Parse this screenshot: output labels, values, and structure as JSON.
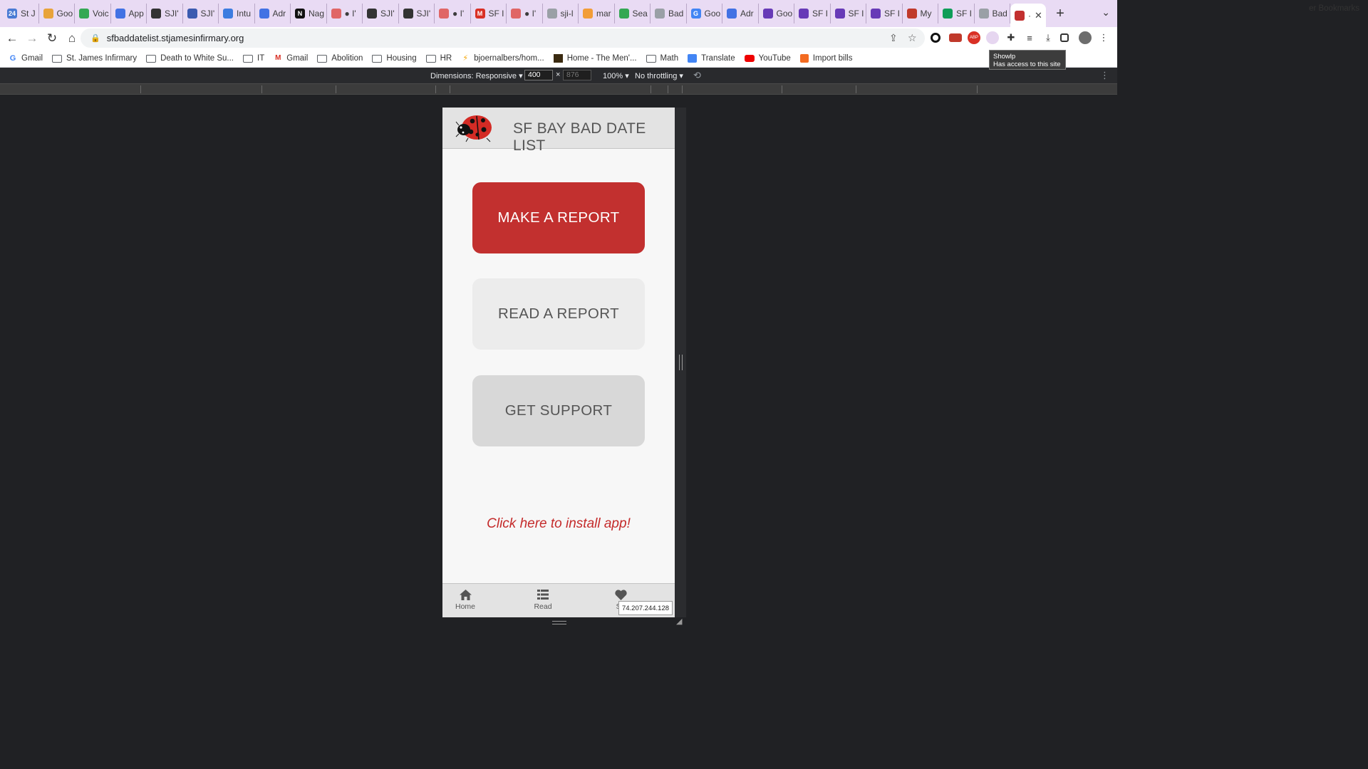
{
  "browser": {
    "tabs": [
      {
        "label": "St J",
        "color": "#4a7bd4",
        "glyph": "24"
      },
      {
        "label": "Goo",
        "color": "#e8a33b",
        "glyph": ""
      },
      {
        "label": "Voic",
        "color": "#34a853",
        "glyph": ""
      },
      {
        "label": "App",
        "color": "#4272e4",
        "glyph": ""
      },
      {
        "label": "SJI'",
        "color": "#333333",
        "glyph": ""
      },
      {
        "label": "SJI'",
        "color": "#3b5bb0",
        "glyph": ""
      },
      {
        "label": "Intu",
        "color": "#3c7ce0",
        "glyph": ""
      },
      {
        "label": "Adr",
        "color": "#4272e4",
        "glyph": ""
      },
      {
        "label": "Nag",
        "color": "#111111",
        "glyph": "N"
      },
      {
        "label": "● I'",
        "color": "#e06666",
        "glyph": ""
      },
      {
        "label": "SJI'",
        "color": "#333333",
        "glyph": ""
      },
      {
        "label": "SJI'",
        "color": "#333333",
        "glyph": ""
      },
      {
        "label": "● I'",
        "color": "#e06666",
        "glyph": ""
      },
      {
        "label": "SF I",
        "color": "#d93025",
        "glyph": "M"
      },
      {
        "label": "● I'",
        "color": "#e06666",
        "glyph": ""
      },
      {
        "label": "sji-l",
        "color": "#9aa0a6",
        "glyph": ""
      },
      {
        "label": "mar",
        "color": "#f29d38",
        "glyph": ""
      },
      {
        "label": "Sea",
        "color": "#34a853",
        "glyph": ""
      },
      {
        "label": "Bad",
        "color": "#9aa0a6",
        "glyph": ""
      },
      {
        "label": "Goo",
        "color": "#4285f4",
        "glyph": "G"
      },
      {
        "label": "Adr",
        "color": "#4272e4",
        "glyph": ""
      },
      {
        "label": "Goo",
        "color": "#673ab7",
        "glyph": ""
      },
      {
        "label": "SF I",
        "color": "#673ab7",
        "glyph": ""
      },
      {
        "label": "SF I",
        "color": "#673ab7",
        "glyph": ""
      },
      {
        "label": "SF I",
        "color": "#673ab7",
        "glyph": ""
      },
      {
        "label": "My",
        "color": "#c0392b",
        "glyph": ""
      },
      {
        "label": "SF I",
        "color": "#0f9d58",
        "glyph": ""
      },
      {
        "label": "Bad",
        "color": "#9aa0a6",
        "glyph": ""
      }
    ],
    "active_tab_label": "·",
    "url": "sfbaddatelist.stjamesinfirmary.org",
    "bookmarks": [
      {
        "label": "Gmail",
        "icon": "google-g"
      },
      {
        "label": "St. James Infirmary",
        "icon": "folder"
      },
      {
        "label": "Death to White Su...",
        "icon": "folder"
      },
      {
        "label": "IT",
        "icon": "folder"
      },
      {
        "label": "Gmail",
        "icon": "gmail"
      },
      {
        "label": "Abolition",
        "icon": "folder"
      },
      {
        "label": "Housing",
        "icon": "folder"
      },
      {
        "label": "HR",
        "icon": "folder"
      },
      {
        "label": "bjoernalbers/hom...",
        "icon": "bolt"
      },
      {
        "label": "Home - The Men'...",
        "icon": "site"
      },
      {
        "label": "Math",
        "icon": "folder"
      },
      {
        "label": "Translate",
        "icon": "translate"
      },
      {
        "label": "YouTube",
        "icon": "youtube"
      },
      {
        "label": "Import bills",
        "icon": "bills"
      }
    ],
    "other_bookmarks": "er Bookmarks",
    "tooltip": {
      "line1": "Showlp",
      "line2": "Has access to this site"
    }
  },
  "devtools": {
    "dimensions_label": "Dimensions: Responsive ▾",
    "width": "400",
    "times": "×",
    "height": "876",
    "zoom": "100% ▾",
    "throttling": "No throttling ▾"
  },
  "app": {
    "title": "SF BAY BAD DATE LIST",
    "buttons": {
      "make": "MAKE A REPORT",
      "read": "READ A REPORT",
      "support": "GET SUPPORT"
    },
    "install": "Click here to install app!",
    "nav": {
      "home": "Home",
      "read": "Read",
      "support": "Su"
    },
    "accent": "#c2302f",
    "ip": "74.207.244.128"
  }
}
